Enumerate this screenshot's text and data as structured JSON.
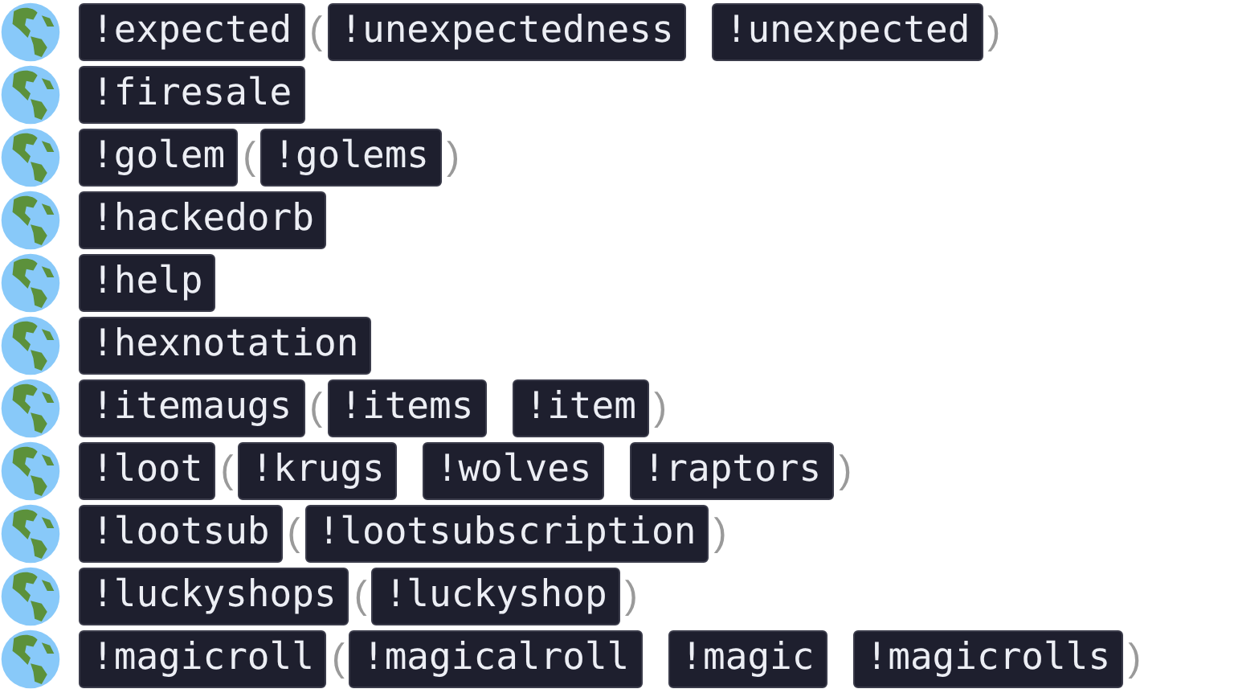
{
  "alias_open": "(",
  "alias_close": ")",
  "rows": [
    {
      "command": "!expected",
      "aliases": [
        "!unexpectedness",
        "!unexpected"
      ]
    },
    {
      "command": "!firesale",
      "aliases": []
    },
    {
      "command": "!golem",
      "aliases": [
        "!golems"
      ]
    },
    {
      "command": "!hackedorb",
      "aliases": []
    },
    {
      "command": "!help",
      "aliases": []
    },
    {
      "command": "!hexnotation",
      "aliases": []
    },
    {
      "command": "!itemaugs",
      "aliases": [
        "!items",
        "!item"
      ]
    },
    {
      "command": "!loot",
      "aliases": [
        "!krugs",
        "!wolves",
        "!raptors"
      ]
    },
    {
      "command": "!lootsub",
      "aliases": [
        "!lootsubscription"
      ]
    },
    {
      "command": "!luckyshops",
      "aliases": [
        "!luckyshop"
      ]
    },
    {
      "command": "!magicroll",
      "aliases": [
        "!magicalroll",
        "!magic",
        "!magicrolls"
      ]
    }
  ]
}
